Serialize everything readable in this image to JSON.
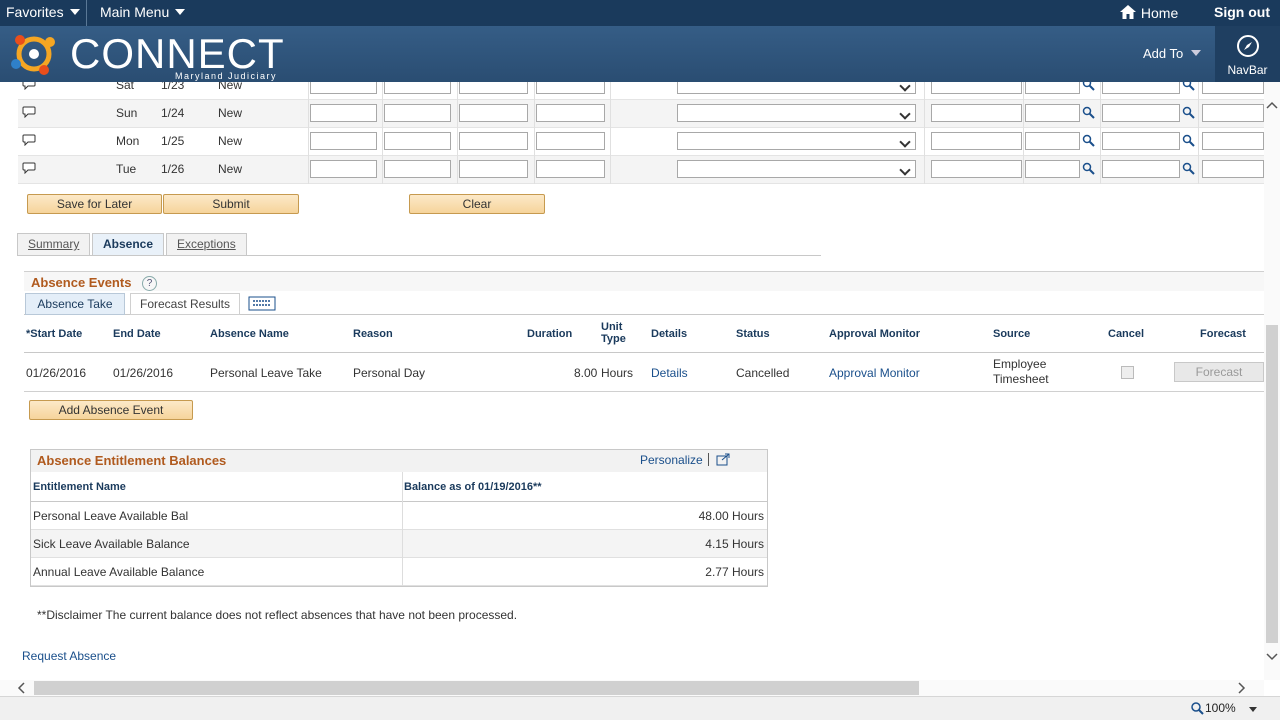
{
  "topbar": {
    "favorites": "Favorites",
    "main_menu": "Main Menu",
    "home": "Home",
    "sign_out": "Sign out"
  },
  "banner": {
    "logo_text": "CONNECT",
    "logo_sub": "Maryland Judiciary",
    "add_to": "Add To",
    "navbar": "NavBar"
  },
  "timesheet_rows": [
    {
      "day": "Sat",
      "date": "1/23",
      "status": "New"
    },
    {
      "day": "Sun",
      "date": "1/24",
      "status": "New"
    },
    {
      "day": "Mon",
      "date": "1/25",
      "status": "New"
    },
    {
      "day": "Tue",
      "date": "1/26",
      "status": "New"
    }
  ],
  "buttons": {
    "save_for_later": "Save for Later",
    "submit": "Submit",
    "clear": "Clear",
    "add_absence_event": "Add Absence Event"
  },
  "tabs": [
    "Summary",
    "Absence",
    "Exceptions"
  ],
  "absence_events": {
    "title": "Absence Events",
    "help": "?",
    "subtabs": [
      "Absence Take",
      "Forecast Results"
    ],
    "columns": [
      "*Start Date",
      "End Date",
      "Absence Name",
      "Reason",
      "Duration",
      "Unit Type",
      "Details",
      "Status",
      "Approval Monitor",
      "Source",
      "Cancel",
      "Forecast"
    ],
    "row": {
      "start_date": "01/26/2016",
      "end_date": "01/26/2016",
      "absence_name": "Personal Leave Take",
      "reason": "Personal Day",
      "duration": "8.00",
      "unit_type": "Hours",
      "details": "Details",
      "status": "Cancelled",
      "approval_monitor": "Approval Monitor",
      "source_line1": "Employee",
      "source_line2": "Timesheet",
      "forecast": "Forecast"
    }
  },
  "balances": {
    "title": "Absence Entitlement Balances",
    "personalize": "Personalize",
    "columns": [
      "Entitlement Name",
      "Balance as of 01/19/2016**"
    ],
    "rows": [
      {
        "name": "Personal Leave Available Bal",
        "value": "48.00 Hours"
      },
      {
        "name": "Sick Leave Available Balance",
        "value": "4.15 Hours"
      },
      {
        "name": "Annual Leave Available Balance",
        "value": "2.77 Hours"
      }
    ]
  },
  "disclaimer": "**Disclaimer  The current balance does not reflect absences that have not been processed.",
  "request_absence": "Request Absence",
  "status_bar": {
    "zoom": "100%"
  }
}
